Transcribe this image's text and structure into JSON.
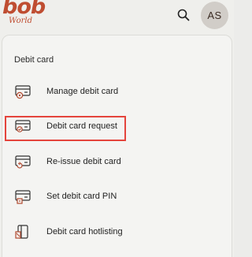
{
  "brand": {
    "name": "bob",
    "tagline": "World",
    "color": "#bf4d31"
  },
  "header": {
    "search_icon": "search-icon",
    "avatar_initials": "AS"
  },
  "section": {
    "title": "Debit card"
  },
  "menu": {
    "items": [
      {
        "label": "Manage debit card",
        "icon": "card-settings-icon"
      },
      {
        "label": "Debit card request",
        "icon": "card-request-icon",
        "highlighted": true
      },
      {
        "label": "Re-issue debit card",
        "icon": "card-reissue-icon"
      },
      {
        "label": "Set debit card PIN",
        "icon": "card-pin-icon"
      },
      {
        "label": "Debit card hotlisting",
        "icon": "card-hotlist-icon"
      }
    ]
  },
  "colors": {
    "accent": "#bf4d31",
    "highlight_border": "#e4443c"
  }
}
